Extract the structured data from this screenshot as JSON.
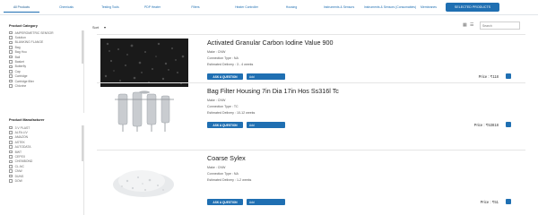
{
  "tabs": [
    {
      "label": "All Products",
      "active": true
    },
    {
      "label": "Chemicals"
    },
    {
      "label": "Testing Tools"
    },
    {
      "label": "PDP Heater"
    },
    {
      "label": "Filters"
    },
    {
      "label": "Heater Controller"
    },
    {
      "label": "Housing"
    },
    {
      "label": "Instruments & Sensors"
    },
    {
      "label": "Instruments & Sensors (Consumables)"
    },
    {
      "label": "Membranes"
    }
  ],
  "selected_products_label": "SELECTED PRODUCTS",
  "sort": {
    "label": "Sort"
  },
  "search": {
    "placeholder": "Search"
  },
  "category": {
    "title": "Product Category",
    "items": [
      "AMPEROMETRIC SENSOR",
      "Solution",
      "BLANKING FLANGE",
      "Bag",
      "Bag Hou",
      "Ball",
      "Basket",
      "Butterfly",
      "Cap",
      "Cartridge",
      "Cartridge filter",
      "Chlorine"
    ]
  },
  "manufacturer": {
    "title": "Product Manufacturer",
    "items": [
      "3 V PLAST",
      "ALFA LIV",
      "AMAZON",
      "ASTEK",
      "AUTODATA",
      "BWT",
      "CEPEX",
      "CHEMBOND",
      "CL-NC",
      "CNW",
      "DUNS",
      "DOW"
    ]
  },
  "products": [
    {
      "name": "Activated Granular Carbon Iodine Value 900",
      "make": "Make : CNW",
      "connection": "Connection Type : NA",
      "delivery": "Estimated Delivery : 3 - 4 weeks",
      "ask_label": "ASK A QUESTION",
      "add_label": "Add",
      "price": "Price : ₹118",
      "image_type": "carbon"
    },
    {
      "name": "Bag Filter Housing 7in Dia 17in Hos Ss316l Tc",
      "make": "Make : CNW",
      "connection": "Connection Type : TC",
      "delivery": "Estimated Delivery : 10-12 weeks",
      "ask_label": "ASK A QUESTION",
      "add_label": "Add",
      "price": "Price : ₹53818",
      "image_type": "housing"
    },
    {
      "name": "Coarse Sylex",
      "make": "Make : CNW",
      "connection": "Connection Type : NA",
      "delivery": "Estimated Delivery : 1-2 weeks",
      "ask_label": "ASK A QUESTION",
      "add_label": "Add",
      "price": "Price : ₹51",
      "image_type": "sylex"
    }
  ],
  "colors": {
    "accent": "#1f6fb2"
  }
}
